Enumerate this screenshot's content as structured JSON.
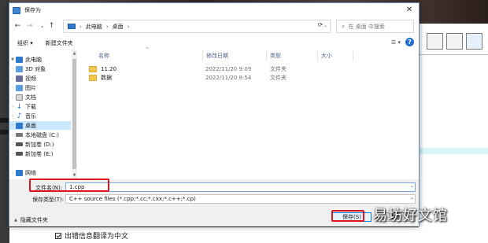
{
  "dialog": {
    "title": "保存为",
    "close_glyph": "✕"
  },
  "nav": {
    "back_glyph": "←",
    "forward_glyph": "→",
    "recent_glyph": "⌄",
    "up_glyph": "↑",
    "refresh_glyph": "⟳"
  },
  "address": {
    "separator": "›",
    "crumbs": [
      "此电脑",
      "桌面"
    ],
    "dropdown_glyph": "⌄"
  },
  "search": {
    "placeholder": "在 桌面 中搜索",
    "icon": "⌕"
  },
  "toolbar": {
    "organize_label": "组织 ▾",
    "new_folder_label": "新建文件夹",
    "view_glyph": "☰ ▾"
  },
  "help": {
    "label": "?"
  },
  "tree": [
    {
      "label": "此电脑",
      "icon": "pc-icon",
      "color": "#2e7ad1",
      "expanded": true
    },
    {
      "label": "3D 对象",
      "icon": "cube-icon",
      "color": "#5aa0e0"
    },
    {
      "label": "视频",
      "icon": "video-icon",
      "color": "#6b6b9b"
    },
    {
      "label": "图片",
      "icon": "pictures-icon",
      "color": "#5aa0e0"
    },
    {
      "label": "文档",
      "icon": "document-icon",
      "color": "#8a8a8a"
    },
    {
      "label": "下载",
      "icon": "download-icon",
      "color": "#1f6fd0"
    },
    {
      "label": "音乐",
      "icon": "music-icon",
      "color": "#1f6fd0"
    },
    {
      "label": "桌面",
      "icon": "desktop-icon",
      "color": "#2e7ad1",
      "selected": true
    },
    {
      "label": "本地磁盘 (C:)",
      "icon": "drive-icon",
      "color": "#555555"
    },
    {
      "label": "新加卷 (D:)",
      "icon": "drive-icon",
      "color": "#555555"
    },
    {
      "label": "新加卷 (E:)",
      "icon": "drive-icon",
      "color": "#555555"
    },
    {
      "label": "网络",
      "icon": "network-icon",
      "color": "#2e7ad1"
    }
  ],
  "columns": {
    "name": "名称",
    "date": "修改日期",
    "type": "类型",
    "size": "大小"
  },
  "files": [
    {
      "name": "11.20",
      "date": "2022/11/20 9:09",
      "type": "文件夹"
    },
    {
      "name": "数据",
      "date": "2022/11/20 8:54",
      "type": "文件夹"
    }
  ],
  "save": {
    "filename_label": "文件名(N):",
    "filename_value": "1.cpp",
    "filetype_label": "保存类型(T):",
    "filetype_value": "C++ source files (*.cpp;*.cc;*.cxx;*.c++;*.cp)",
    "hide_folders_label": "隐藏文件夹",
    "save_button": "保存(S)",
    "cancel_button": "取消"
  },
  "background_app": {
    "checkbox_label": "出错信息翻译为中文"
  },
  "watermark": "易坊好文馆",
  "colors": {
    "highlight": "#e0141e",
    "selection": "#cce8ff",
    "accent": "#0078d7"
  }
}
